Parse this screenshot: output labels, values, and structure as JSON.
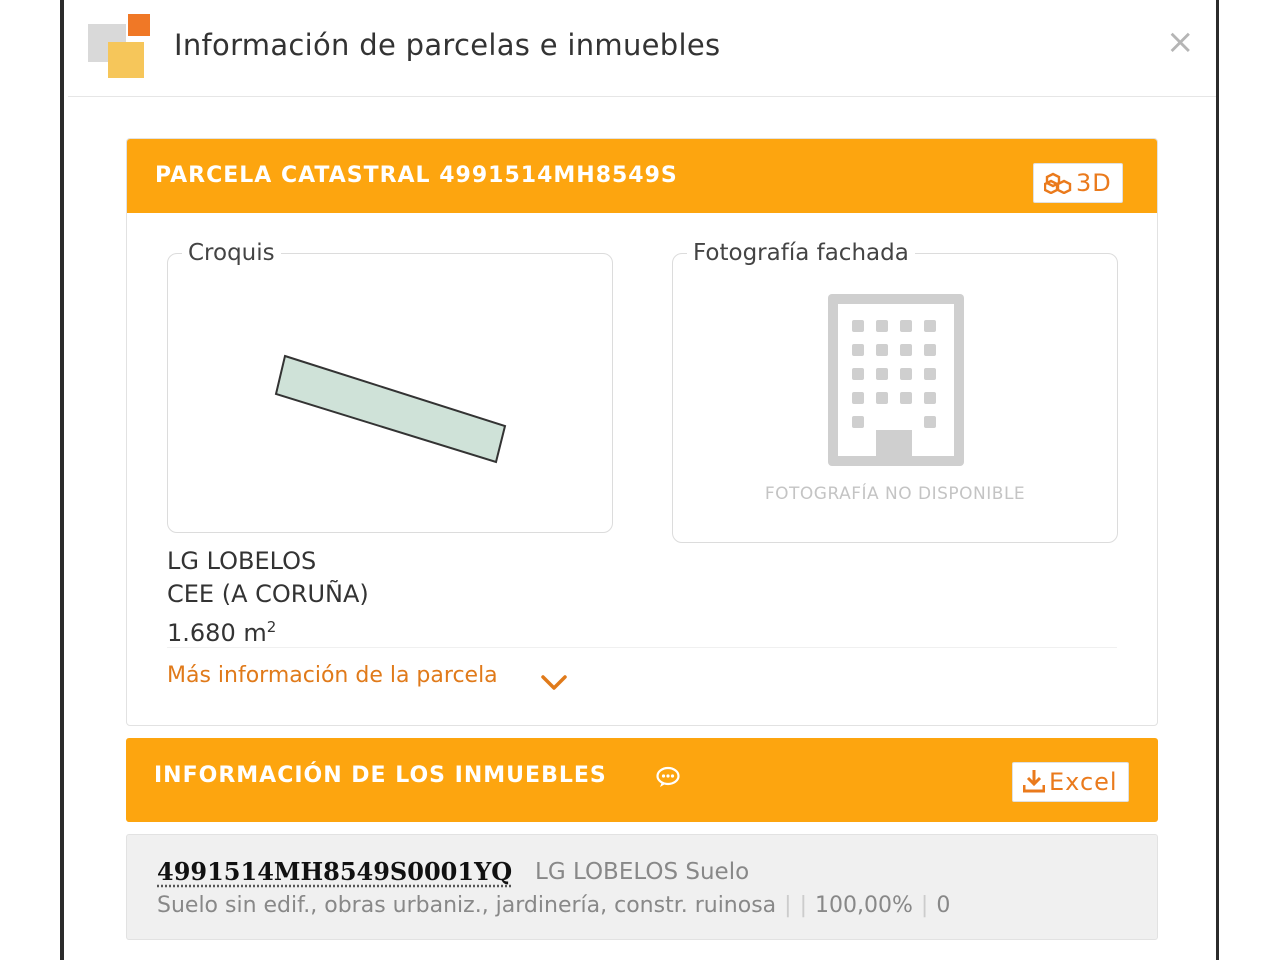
{
  "window": {
    "title": "Información de parcelas e inmuebles",
    "close_label": "×"
  },
  "parcel": {
    "header": "PARCELA CATASTRAL 4991514MH8549S",
    "btn_3d": "3D",
    "croquis_legend": "Croquis",
    "foto_legend": "Fotografía fachada",
    "foto_unavailable": "FOTOGRAFÍA NO DISPONIBLE",
    "address_line1": "LG LOBELOS",
    "address_line2": "CEE (A CORUÑA)",
    "area_value": "1.680 m",
    "area_sup": "2",
    "more_info": "Más información de la parcela"
  },
  "inmuebles": {
    "header": "INFORMACIÓN DE LOS INMUEBLES",
    "excel_label": "Excel",
    "items": [
      {
        "reference": "4991514MH8549S0001YQ",
        "address": "LG LOBELOS Suelo",
        "use": "Suelo sin edif., obras urbaniz., jardinería, constr. ruinosa",
        "blank": "",
        "percent": "100,00%",
        "year": "0"
      }
    ]
  },
  "colors": {
    "accent": "#fda50f",
    "link": "#e07a1a",
    "sketch_fill": "#cfe2d8"
  }
}
